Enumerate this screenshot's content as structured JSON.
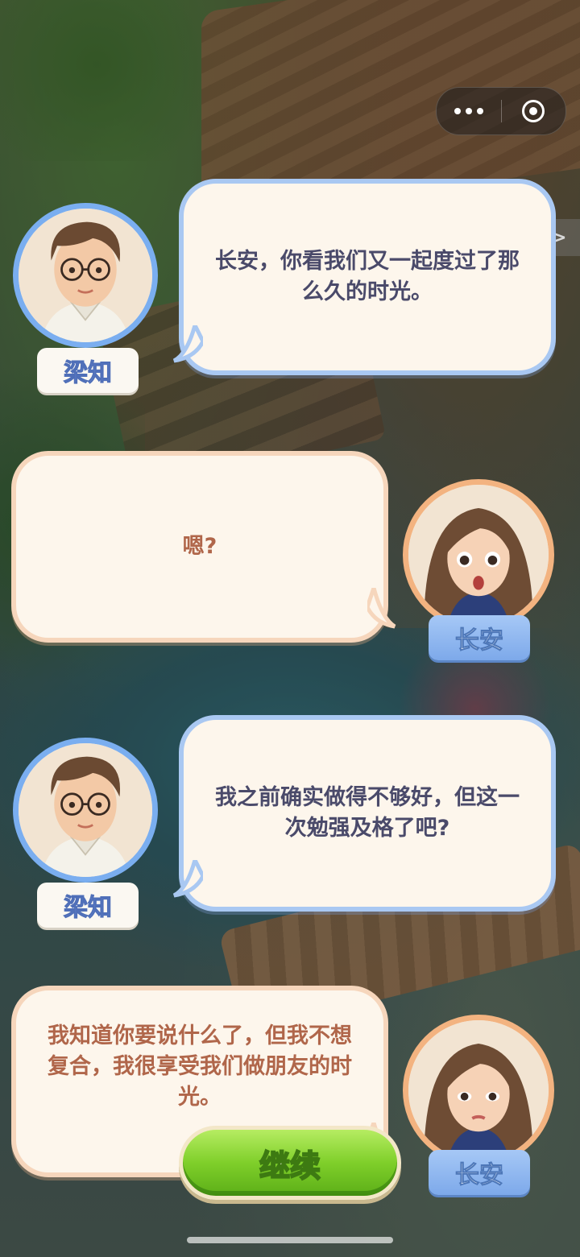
{
  "top_controls": {
    "more_icon": "more-dots-icon",
    "close_icon": "target-circle-icon",
    "skip_label": ">>"
  },
  "dialogue": [
    {
      "speaker": "梁知",
      "side": "left",
      "text": "长安，你看我们又一起度过了那么久的时光。"
    },
    {
      "speaker": "长安",
      "side": "right",
      "text": "嗯?"
    },
    {
      "speaker": "梁知",
      "side": "left",
      "text": "我之前确实做得不够好，但这一次勉强及格了吧?"
    },
    {
      "speaker": "长安",
      "side": "right",
      "text": "我知道你要说什么了，但我不想复合，我很享受我们做朋友的时光。"
    }
  ],
  "continue_label": "继续",
  "colors": {
    "left_bubble_border": "#a9c8f2",
    "right_bubble_border": "#f6d6bc",
    "left_text": "#4a4a6a",
    "right_text": "#b0664a",
    "continue_green": "#7fcf2a"
  }
}
